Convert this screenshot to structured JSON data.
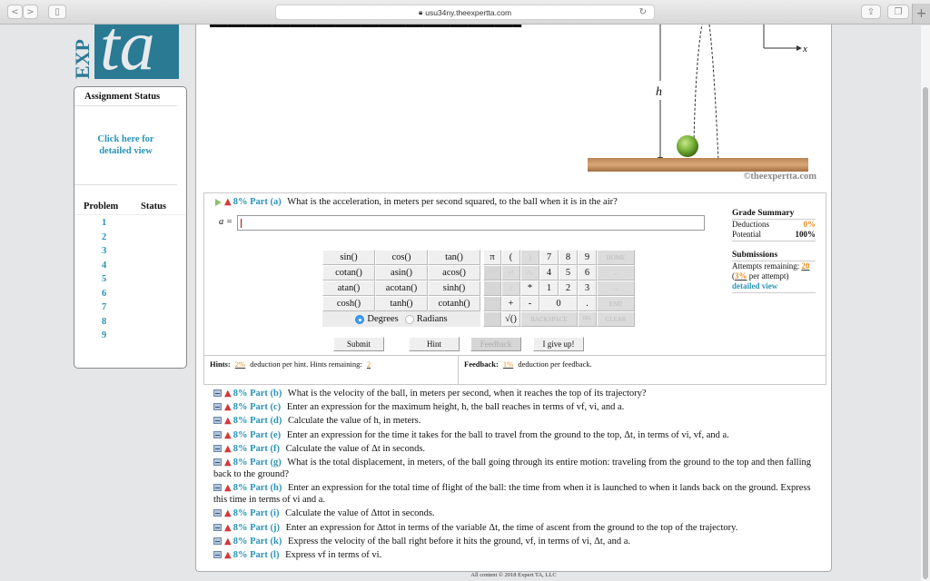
{
  "browser": {
    "url": "usu34ny.theexpertta.com",
    "lock_icon": "lock-icon",
    "back_label": "<",
    "forward_label": ">",
    "newtab_label": "+"
  },
  "logo": {
    "exp": "EXP",
    "ta": "ta"
  },
  "sidebar": {
    "title": "Assignment Status",
    "detail_link": "Click here for detailed view",
    "col_problem": "Problem",
    "col_status": "Status",
    "problems": [
      "1",
      "2",
      "3",
      "4",
      "5",
      "6",
      "7",
      "8",
      "9"
    ]
  },
  "figure": {
    "h_label": "h",
    "x_label": "x",
    "credit": "©theexpertta.com"
  },
  "part_a": {
    "pct": "8%",
    "label": "Part (a)",
    "question": "What is the acceleration, in meters per second squared, to the ball when it is in the air?",
    "answer_label": "a =",
    "answer_value": ""
  },
  "grade_summary": {
    "title": "Grade Summary",
    "deductions_label": "Deductions",
    "deductions_value": "0%",
    "potential_label": "Potential",
    "potential_value": "100%",
    "submissions_title": "Submissions",
    "attempts_label": "Attempts remaining:",
    "attempts_value": "20",
    "per_attempt_pct": "3%",
    "per_attempt_label": "per attempt)",
    "detailed_view": "detailed view"
  },
  "calculator": {
    "functions": [
      "sin()",
      "cos()",
      "tan()",
      "cotan()",
      "asin()",
      "acos()",
      "atan()",
      "acotan()",
      "sinh()",
      "cosh()",
      "tanh()",
      "cotanh()"
    ],
    "degrees_label": "Degrees",
    "radians_label": "Radians",
    "angle_mode": "Degrees",
    "numpad": {
      "pi": "π",
      "lparen": "(",
      "rparen": ")",
      "seven": "7",
      "eight": "8",
      "nine": "9",
      "home": "HOME",
      "up": "↑^",
      "down": "^↓",
      "four": "4",
      "five": "5",
      "six": "6",
      "left": "←",
      "divide": "/",
      "multiply": "*",
      "one": "1",
      "two": "2",
      "three": "3",
      "right": "→",
      "plus": "+",
      "minus": "-",
      "zero": "0",
      "dot": ".",
      "end": "END",
      "sqrt": "√()",
      "backspace": "BACKSPACE",
      "del": "DEL",
      "clear": "CLEAR"
    }
  },
  "actions": {
    "submit": "Submit",
    "hint": "Hint",
    "feedback": "Feedback",
    "give_up": "I give up!"
  },
  "hints": {
    "label": "Hints:",
    "pct": "2%",
    "text": "deduction per hint. Hints remaining:",
    "remaining": "2"
  },
  "feedback": {
    "label": "Feedback:",
    "pct": "1%",
    "text": "deduction per feedback."
  },
  "parts": [
    {
      "pct": "8%",
      "label": "Part (b)",
      "text": "What is the velocity of the ball, in meters per second, when it reaches the top of its trajectory?"
    },
    {
      "pct": "8%",
      "label": "Part (c)",
      "text": "Enter an expression for the maximum height, h, the ball reaches in terms of vf, vi, and a."
    },
    {
      "pct": "8%",
      "label": "Part (d)",
      "text": "Calculate the value of h, in meters."
    },
    {
      "pct": "8%",
      "label": "Part (e)",
      "text": "Enter an expression for the time it takes for the ball to travel from the ground to the top, Δt, in terms of vi, vf, and a."
    },
    {
      "pct": "8%",
      "label": "Part (f)",
      "text": "Calculate the value of Δt in seconds."
    },
    {
      "pct": "8%",
      "label": "Part (g)",
      "text": "What is the total displacement, in meters, of the ball going through its entire motion: traveling from the ground to the top and then falling back to the ground?"
    },
    {
      "pct": "8%",
      "label": "Part (h)",
      "text": "Enter an expression for the total time of flight of the ball: the time from when it is launched to when it lands back on the ground. Express this time in terms of vi and a."
    },
    {
      "pct": "8%",
      "label": "Part (i)",
      "text": "Calculate the value of Δttot in seconds."
    },
    {
      "pct": "8%",
      "label": "Part (j)",
      "text": "Enter an expression for Δttot in terms of the variable Δt, the time of ascent from the ground to the top of the trajectory."
    },
    {
      "pct": "8%",
      "label": "Part (k)",
      "text": "Express the velocity of the ball right before it hits the ground, vf, in terms of vi, Δt, and a."
    },
    {
      "pct": "8%",
      "label": "Part (l)",
      "text": "Express vf in terms of vi."
    }
  ],
  "footer": "All content © 2018 Expert TA, LLC"
}
